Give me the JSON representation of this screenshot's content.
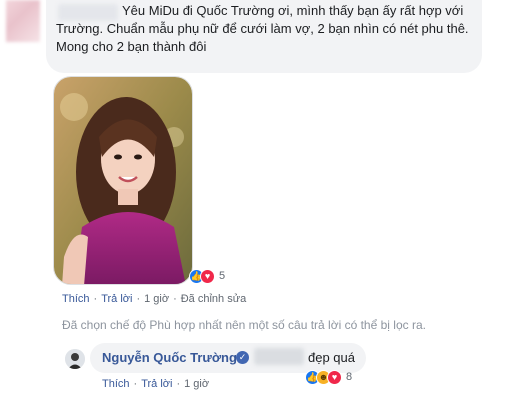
{
  "comment": {
    "text": "Yêu MiDu đi Quốc Trường ơi, mình thấy bạn ấy rất hợp với Trường. Chuẩn mẫu phụ nữ để cưới làm vợ, 2 bạn nhìn có nét phu thê. Mong cho 2 bạn thành đôi",
    "reaction_count": "5",
    "actions": {
      "like": "Thích",
      "reply": "Trả lời",
      "time": "1 giờ",
      "edited": "Đã chỉnh sửa"
    }
  },
  "notice": "Đã chọn chế độ Phù hợp nhất nên một số câu trả lời có thể bị lọc ra.",
  "reply": {
    "author": "Nguyễn Quốc Trường",
    "text": "đẹp quá",
    "reaction_count": "8",
    "actions": {
      "like": "Thích",
      "reply": "Trả lời",
      "time": "1 giờ"
    }
  },
  "colors": {
    "bubble": "#f2f3f5",
    "link": "#385898",
    "meta": "#606770",
    "like": "#1877f2",
    "love": "#f0284a",
    "haha": "#f7b125"
  },
  "icons": [
    "like-icon",
    "love-icon",
    "haha-icon",
    "verified-badge-icon"
  ]
}
